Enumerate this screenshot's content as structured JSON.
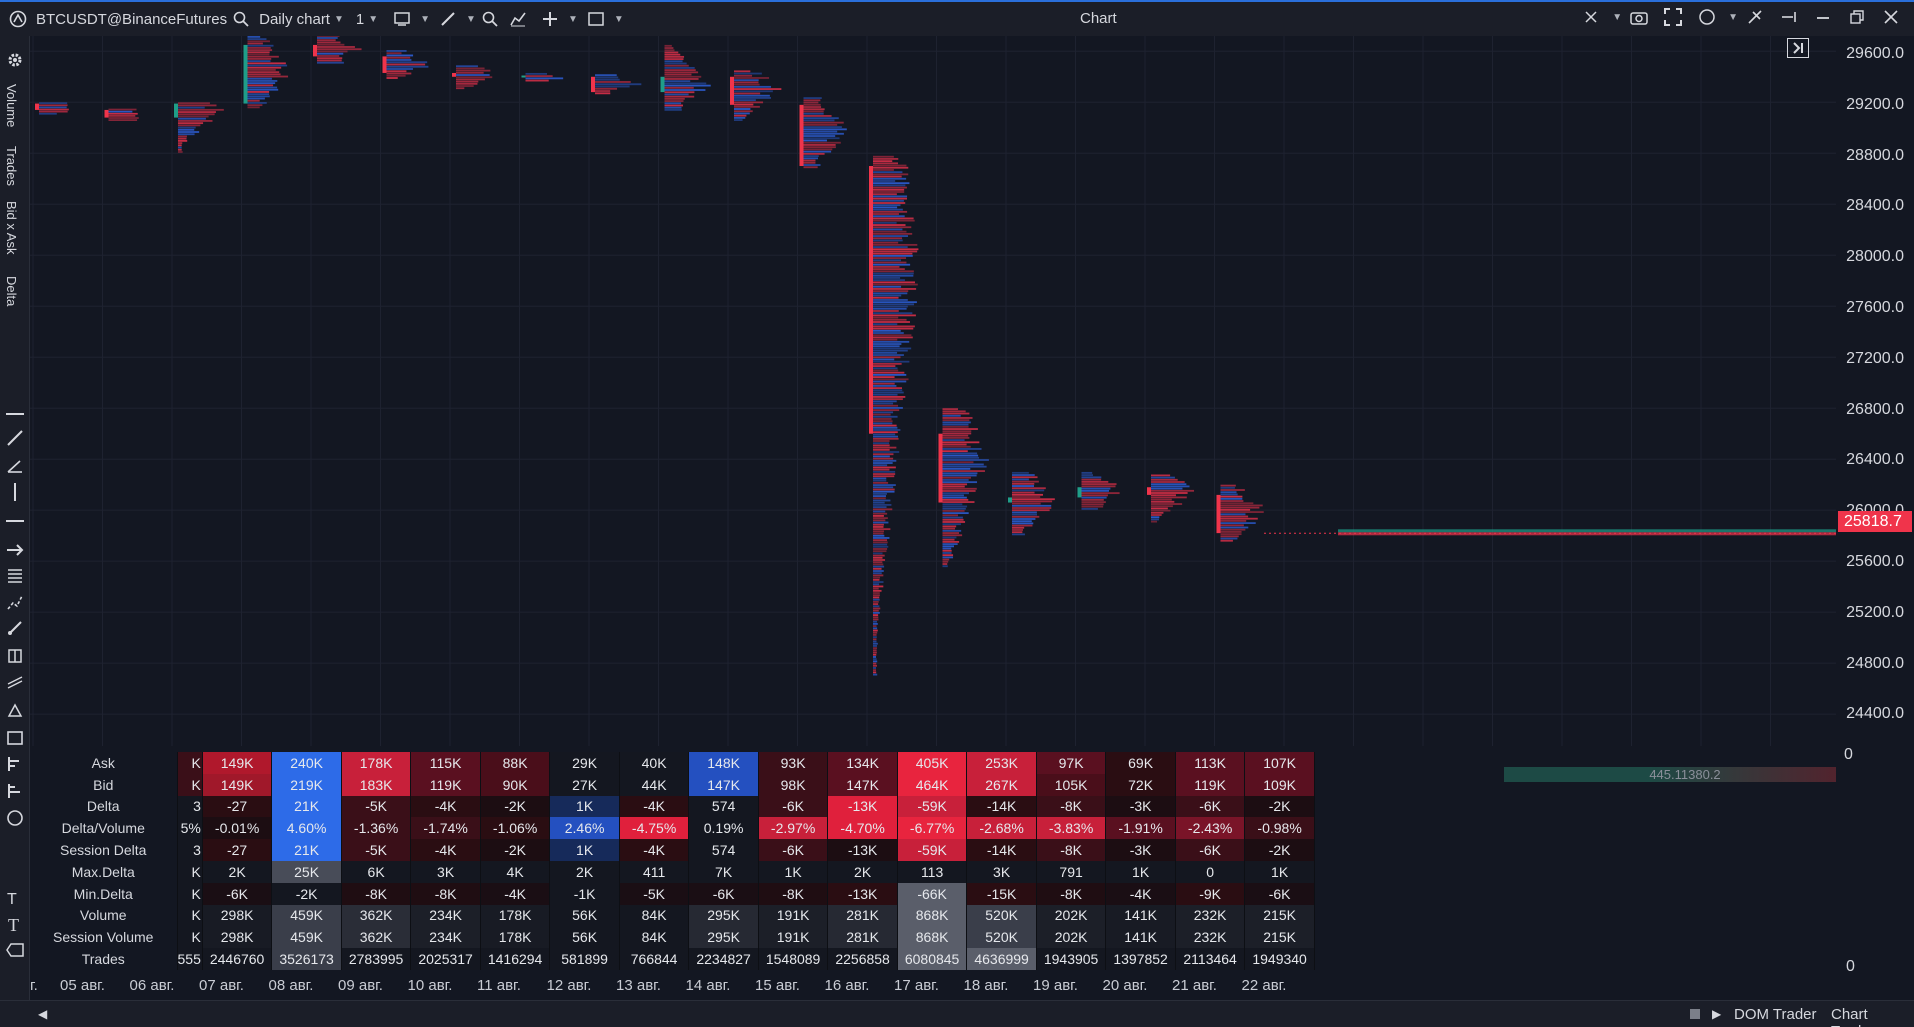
{
  "titlebar": {
    "symbol": "BTCUSDT@BinanceFutures",
    "chart_type": "Daily chart",
    "period": "1",
    "title": "Chart"
  },
  "left_panel": {
    "indicator_labels": [
      "Volume",
      "Trades",
      "Bid x Ask",
      "Delta"
    ]
  },
  "price_axis": {
    "labels": [
      "29600.0",
      "29200.0",
      "28800.0",
      "28400.0",
      "28000.0",
      "27600.0",
      "27200.0",
      "26800.0",
      "26400.0",
      "26000.0",
      "25600.0",
      "25200.0",
      "24800.0",
      "24400.0"
    ],
    "current_price": "25818.7",
    "table_axis_top": "0",
    "table_axis_bottom": "0",
    "stat_bar_text": "445.11380.2"
  },
  "stats_table": {
    "row_labels": [
      "Ask",
      "Bid",
      "Delta",
      "Delta/Volume",
      "Session Delta",
      "Max.Delta",
      "Min.Delta",
      "Volume",
      "Session Volume",
      "Trades"
    ],
    "partial_column": [
      "K",
      "K",
      "3",
      "5%",
      "3",
      "K",
      "K",
      "K",
      "K",
      "555"
    ],
    "columns": [
      [
        "149K",
        "149K",
        "-27",
        "-0.01%",
        "-27",
        "2K",
        "-6K",
        "298K",
        "298K",
        "2446760"
      ],
      [
        "240K",
        "219K",
        "21K",
        "4.60%",
        "21K",
        "25K",
        "-2K",
        "459K",
        "459K",
        "3526173"
      ],
      [
        "178K",
        "183K",
        "-5K",
        "-1.36%",
        "-5K",
        "6K",
        "-8K",
        "362K",
        "362K",
        "2783995"
      ],
      [
        "115K",
        "119K",
        "-4K",
        "-1.74%",
        "-4K",
        "3K",
        "-8K",
        "234K",
        "234K",
        "2025317"
      ],
      [
        "88K",
        "90K",
        "-2K",
        "-1.06%",
        "-2K",
        "4K",
        "-4K",
        "178K",
        "178K",
        "1416294"
      ],
      [
        "29K",
        "27K",
        "1K",
        "2.46%",
        "1K",
        "2K",
        "-1K",
        "56K",
        "56K",
        "581899"
      ],
      [
        "40K",
        "44K",
        "-4K",
        "-4.75%",
        "-4K",
        "411",
        "-5K",
        "84K",
        "84K",
        "766844"
      ],
      [
        "148K",
        "147K",
        "574",
        "0.19%",
        "574",
        "7K",
        "-6K",
        "295K",
        "295K",
        "2234827"
      ],
      [
        "93K",
        "98K",
        "-6K",
        "-2.97%",
        "-6K",
        "1K",
        "-8K",
        "191K",
        "191K",
        "1548089"
      ],
      [
        "134K",
        "147K",
        "-13K",
        "-4.70%",
        "-13K",
        "2K",
        "-13K",
        "281K",
        "281K",
        "2256858"
      ],
      [
        "405K",
        "464K",
        "-59K",
        "-6.77%",
        "-59K",
        "113",
        "-66K",
        "868K",
        "868K",
        "6080845"
      ],
      [
        "253K",
        "267K",
        "-14K",
        "-2.68%",
        "-14K",
        "3K",
        "-15K",
        "520K",
        "520K",
        "4636999"
      ],
      [
        "97K",
        "105K",
        "-8K",
        "-3.83%",
        "-8K",
        "791",
        "-8K",
        "202K",
        "202K",
        "1943905"
      ],
      [
        "69K",
        "72K",
        "-3K",
        "-1.91%",
        "-3K",
        "1K",
        "-4K",
        "141K",
        "141K",
        "1397852"
      ],
      [
        "113K",
        "119K",
        "-6K",
        "-2.43%",
        "-6K",
        "0",
        "-9K",
        "232K",
        "232K",
        "2113464"
      ],
      [
        "107K",
        "109K",
        "-2K",
        "-0.98%",
        "-2K",
        "1K",
        "-6K",
        "215K",
        "215K",
        "1949340"
      ]
    ],
    "colors": [
      [
        "#b0182c",
        "#a0182a",
        "#2a0d12",
        "#1c0d12",
        "#2a0d12",
        "#141720",
        "#1a0e14",
        "#181b24",
        "#181b24",
        "#141720"
      ],
      [
        "#2d6be8",
        "#2d6be8",
        "#2d6be8",
        "#2d6be8",
        "#2d6be8",
        "#484c58",
        "#141720",
        "#3a3e4a",
        "#3a3e4a",
        "#3a3e4a"
      ],
      [
        "#c8203a",
        "#c8203a",
        "#3a0f18",
        "#3a0f18",
        "#3a0f18",
        "#141720",
        "#1f0d12",
        "#2a2d37",
        "#2a2d37",
        "#141720"
      ],
      [
        "#5a1020",
        "#5a1020",
        "#2a0d12",
        "#3a0f18",
        "#2a0d12",
        "#141720",
        "#1f0d12",
        "#1c1f28",
        "#1c1f28",
        "#141720"
      ],
      [
        "#4a0e1a",
        "#4a0e1a",
        "#1c0d12",
        "#2a0d12",
        "#1c0d12",
        "#141720",
        "#1a0e14",
        "#181b24",
        "#181b24",
        "#141720"
      ],
      [
        "#141720",
        "#141720",
        "#162a5a",
        "#2450c0",
        "#162a5a",
        "#141720",
        "#141720",
        "#141720",
        "#141720",
        "#141720"
      ],
      [
        "#141720",
        "#141720",
        "#2a0d12",
        "#e0203c",
        "#2a0d12",
        "#141720",
        "#1a0e14",
        "#141720",
        "#141720",
        "#141720"
      ],
      [
        "#2450c0",
        "#2450c0",
        "#141720",
        "#141720",
        "#141720",
        "#141720",
        "#1a0e14",
        "#262933",
        "#262933",
        "#141720"
      ],
      [
        "#3a0f18",
        "#3a0f18",
        "#3a0f18",
        "#c8203a",
        "#3a0f18",
        "#141720",
        "#1f0d12",
        "#1c1f28",
        "#1c1f28",
        "#141720"
      ],
      [
        "#5a1020",
        "#5a1020",
        "#e0203c",
        "#e0203c",
        "#1c0d12",
        "#141720",
        "#2a0d12",
        "#262933",
        "#262933",
        "#141720"
      ],
      [
        "#e8243e",
        "#e8243e",
        "#c8203a",
        "#e8243e",
        "#c8203a",
        "#141720",
        "#5a5e6a",
        "#5a5e6a",
        "#5a5e6a",
        "#5a5e6a"
      ],
      [
        "#c8203a",
        "#c8203a",
        "#2a0d12",
        "#c8203a",
        "#2a0d12",
        "#141720",
        "#2a0d12",
        "#3a3e4a",
        "#3a3e4a",
        "#5a5e6a"
      ],
      [
        "#5a1020",
        "#4a0e1a",
        "#3a0f18",
        "#c8203a",
        "#3a0f18",
        "#141720",
        "#1f0d12",
        "#1c1f28",
        "#1c1f28",
        "#141720"
      ],
      [
        "#2a0d12",
        "#2a0d12",
        "#1c0d12",
        "#5a1020",
        "#1c0d12",
        "#141720",
        "#1a0e14",
        "#181b24",
        "#181b24",
        "#141720"
      ],
      [
        "#5a1020",
        "#5a1020",
        "#3a0f18",
        "#7a1428",
        "#3a0f18",
        "#141720",
        "#2a0d12",
        "#1c1f28",
        "#1c1f28",
        "#141720"
      ],
      [
        "#5a1020",
        "#5a1020",
        "#1c0d12",
        "#3a0f18",
        "#1c0d12",
        "#141720",
        "#1a0e14",
        "#1c1f28",
        "#1c1f28",
        "#141720"
      ]
    ]
  },
  "dates": [
    "05 авг.",
    "06 авг.",
    "07 авг.",
    "08 авг.",
    "09 авг.",
    "10 авг.",
    "11 авг.",
    "12 авг.",
    "13 авг.",
    "14 авг.",
    "15 авг.",
    "16 авг.",
    "17 авг.",
    "18 авг.",
    "19 авг.",
    "20 авг.",
    "21 авг.",
    "22 авг."
  ],
  "partial_date": "г.",
  "bottombar": {
    "dom_trader": "DOM Trader",
    "chart_trader": "Chart Trader"
  },
  "candles": [
    {
      "date": "05 авг.",
      "open": 29190,
      "close": 29140,
      "high": 29200,
      "low": 29100
    },
    {
      "date": "06 авг.",
      "open": 29140,
      "close": 29080,
      "high": 29150,
      "low": 29050
    },
    {
      "date": "07 авг.",
      "open": 29080,
      "close": 29190,
      "high": 29200,
      "low": 28800
    },
    {
      "date": "08 авг.",
      "open": 29190,
      "close": 29650,
      "high": 29720,
      "low": 29150
    },
    {
      "date": "09 авг.",
      "open": 29650,
      "close": 29560,
      "high": 29800,
      "low": 29500
    },
    {
      "date": "10 авг.",
      "open": 29560,
      "close": 29430,
      "high": 29610,
      "low": 29380
    },
    {
      "date": "11 авг.",
      "open": 29430,
      "close": 29400,
      "high": 29490,
      "low": 29300
    },
    {
      "date": "12 авг.",
      "open": 29400,
      "close": 29410,
      "high": 29430,
      "low": 29360
    },
    {
      "date": "13 авг.",
      "open": 29400,
      "close": 29280,
      "high": 29420,
      "low": 29260
    },
    {
      "date": "14 авг.",
      "open": 29280,
      "close": 29400,
      "high": 29650,
      "low": 29130
    },
    {
      "date": "15 авг.",
      "open": 29400,
      "close": 29180,
      "high": 29450,
      "low": 29050
    },
    {
      "date": "16 авг.",
      "open": 29180,
      "close": 28700,
      "high": 29240,
      "low": 28680
    },
    {
      "date": "17 авг.",
      "open": 28700,
      "close": 26600,
      "high": 28780,
      "low": 24700
    },
    {
      "date": "18 авг.",
      "open": 26600,
      "close": 26060,
      "high": 26800,
      "low": 25550
    },
    {
      "date": "19 авг.",
      "open": 26060,
      "close": 26100,
      "high": 26300,
      "low": 25800
    },
    {
      "date": "20 авг.",
      "open": 26100,
      "close": 26180,
      "high": 26300,
      "low": 26000
    },
    {
      "date": "21 авг.",
      "open": 26180,
      "close": 26120,
      "high": 26280,
      "low": 25900
    },
    {
      "date": "22 авг.",
      "open": 26120,
      "close": 25820,
      "high": 26200,
      "low": 25750
    }
  ],
  "price_range": [
    24150,
    29720
  ],
  "colors": {
    "bull": "#1f9e89",
    "bear": "#f0344b",
    "ask": "#e0304a",
    "bid": "#2d5fd8",
    "accent": "#2a6fdb"
  }
}
